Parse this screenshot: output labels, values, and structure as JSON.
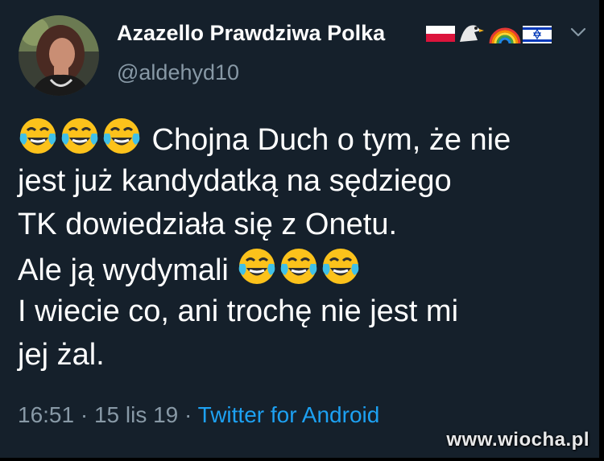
{
  "author": {
    "display_name": "Azazello Prawdziwa Polka",
    "handle": "@aldehyd10",
    "flag_emojis": [
      "flag-poland-icon",
      "eagle-icon",
      "rainbow-icon",
      "flag-israel-icon"
    ]
  },
  "tweet": {
    "lines": [
      " Chojna Duch o tym, że nie",
      "jest już kandydatką na sędziego",
      "TK dowiedziała się z Onetu.",
      "Ale ją wydymali ",
      "I wiecie co, ani trochę nie jest mi",
      "jej żal."
    ]
  },
  "meta": {
    "time": "16:51",
    "separator1": " · ",
    "date": "15 lis 19",
    "separator2": " · ",
    "source": "Twitter for Android"
  },
  "watermark": "www.wiocha.pl",
  "colors": {
    "background": "#15202b",
    "text": "#ffffff",
    "secondary": "#8899a6",
    "link": "#1da1f2"
  }
}
